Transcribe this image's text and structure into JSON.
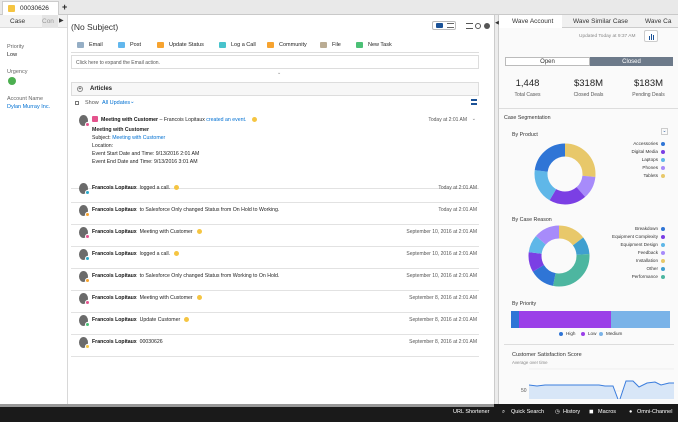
{
  "top_tab": {
    "title": "00030626",
    "add_icon": "plus-icon"
  },
  "left": {
    "tab_case": "Case",
    "tab_con": "Con",
    "priority_label": "Priority",
    "priority_value": "Low",
    "urgency_label": "Urgency",
    "urgency_color": "#4caf50",
    "account_label": "Account Name",
    "account_value": "Dylan Murray Inc."
  },
  "center": {
    "subject": "(No Subject)",
    "actions": [
      "Email",
      "Post",
      "Update Status",
      "Log a Call",
      "Community",
      "File",
      "New Task"
    ],
    "expand_text": "Click here to expand the Email action.",
    "articles_label": "Articles",
    "show_label": "Show",
    "show_value": "All Updates",
    "event": {
      "actor": "Francois Lopitaux",
      "title": "Meeting with Customer",
      "created": "created an event.",
      "timestamp": "Today at 2:01 AM",
      "link_title": "Meeting with Customer",
      "subject_label": "Subject:",
      "subject_value": "Meeting with Customer",
      "location_label": "Location:",
      "start_label": "Event Start Date and Time:",
      "start_value": "9/13/2016 2:01 AM",
      "end_label": "Event End Date and Time:",
      "end_value": "9/13/2016 3:01 AM"
    },
    "feed": [
      {
        "actor": "Francois Lopitaux",
        "text": "logged a call.",
        "ts": "Today at 2:01 AM",
        "badge": "#2aa8c8"
      },
      {
        "actor": "Francois Lopitaux",
        "text": "to Salesforce Only changed Status from On Hold to Working.",
        "ts": "Today at 2:01 AM",
        "badge": "#f7a32f"
      },
      {
        "actor": "Francois Lopitaux",
        "text": "Meeting with Customer",
        "ts": "September 10, 2016 at 2:01 AM",
        "badge": "#e4538d"
      },
      {
        "actor": "Francois Lopitaux",
        "text": "logged a call.",
        "ts": "September 10, 2016 at 2:01 AM",
        "badge": "#2aa8c8"
      },
      {
        "actor": "Francois Lopitaux",
        "text": "to Salesforce Only changed Status from Working to On Hold.",
        "ts": "September 10, 2016 at 2:01 AM",
        "badge": "#f7a32f"
      },
      {
        "actor": "Francois Lopitaux",
        "text": "Meeting with Customer",
        "ts": "September 8, 2016 at 2:01 AM",
        "badge": "#e4538d"
      },
      {
        "actor": "Francois Lopitaux",
        "text": "Update Customer",
        "ts": "September 8, 2016 at 2:01 AM",
        "badge": "#4bc076"
      },
      {
        "actor": "Francois Lopitaux",
        "text": "00030626",
        "ts": "September 8, 2016 at 2:01 AM",
        "badge": "#f5c542"
      }
    ]
  },
  "right": {
    "tabs": [
      "Wave Account",
      "Wave Similar Case",
      "Wave Ca"
    ],
    "updated": "Updated Today at 9:37 AM",
    "seg_open": "Open",
    "seg_closed": "Closed",
    "kpis": [
      {
        "value": "1,448",
        "label": "Total Cases"
      },
      {
        "value": "$318M",
        "label": "Closed Deals"
      },
      {
        "value": "$183M",
        "label": "Pending Deals"
      }
    ],
    "case_segmentation": "Case Segmentation",
    "by_product": "By Product",
    "product_legend": [
      {
        "label": "Accessories",
        "color": "#2f75d6"
      },
      {
        "label": "Digital Media",
        "color": "#7b3fe4"
      },
      {
        "label": "Laptops",
        "color": "#5fb7e8"
      },
      {
        "label": "Phones",
        "color": "#a78bfa"
      },
      {
        "label": "Tablets",
        "color": "#e8c86a"
      }
    ],
    "by_case_reason": "By Case Reason",
    "reason_legend": [
      {
        "label": "Breakdown",
        "color": "#2f75d6"
      },
      {
        "label": "Equipment Complexity",
        "color": "#7b3fe4"
      },
      {
        "label": "Equipment Design",
        "color": "#5fb7e8"
      },
      {
        "label": "Feedback",
        "color": "#a78bfa"
      },
      {
        "label": "Installation",
        "color": "#e8c86a"
      },
      {
        "label": "Other",
        "color": "#3f9fd0"
      },
      {
        "label": "Performance",
        "color": "#4db6a0"
      }
    ],
    "by_priority": "By Priority",
    "priority_legend": [
      {
        "label": "High",
        "color": "#2f75d6"
      },
      {
        "label": "Low",
        "color": "#9b3fe8"
      },
      {
        "label": "Medium",
        "color": "#7ab3e8"
      }
    ],
    "priority_shares": [
      0.05,
      0.58,
      0.37
    ],
    "satisfaction_title": "Customer Satisfaction Score",
    "satisfaction_sub": "Average over time",
    "satisfaction_tick": "50"
  },
  "bottom": {
    "items": [
      "URL Shortener",
      "Quick Search",
      "History",
      "Macros",
      "Omni-Channel"
    ]
  }
}
